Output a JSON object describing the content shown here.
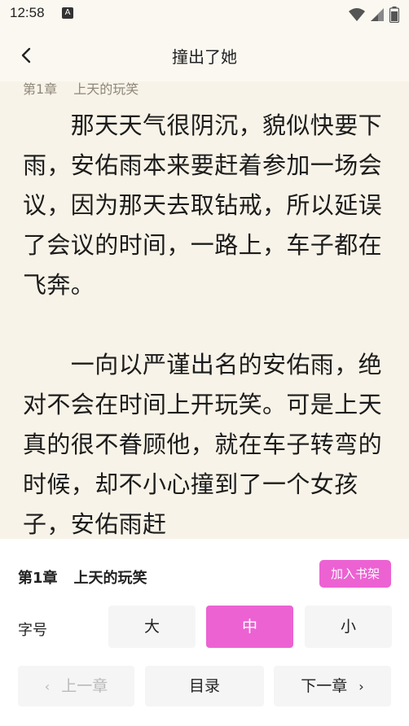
{
  "status_bar": {
    "time": "12:58",
    "notification_badge": "A"
  },
  "header": {
    "back_glyph": "‹",
    "title": "撞出了她"
  },
  "reader": {
    "chapter_number": "第1章",
    "chapter_name": "上天的玩笑",
    "paragraphs": [
      "　　那天天气很阴沉，貌似快要下雨，安佑雨本来要赶着参加一场会议，因为那天去取钻戒，所以延误了会议的时间，一路上，车子都在飞奔。",
      "　　一向以严谨出名的安佑雨，绝对不会在时间上开玩笑。可是上天真的很不眷顾他，就在车子转弯的时候，却不小心撞到了一个女孩子，安佑雨赶"
    ]
  },
  "panel": {
    "chapter_number": "第1章",
    "chapter_name": "上天的玩笑",
    "add_shelf_label": "加入书架",
    "font_size_label": "字号",
    "font_sizes": [
      "大",
      "中",
      "小"
    ],
    "selected_font_size": "中",
    "prev_label": "上一章",
    "toc_label": "目录",
    "next_label": "下一章"
  },
  "colors": {
    "accent": "#ec62d3",
    "reader_bg": "#f8f3e8",
    "header_bg": "#fbf8f1",
    "button_bg": "#f5f5f5"
  }
}
